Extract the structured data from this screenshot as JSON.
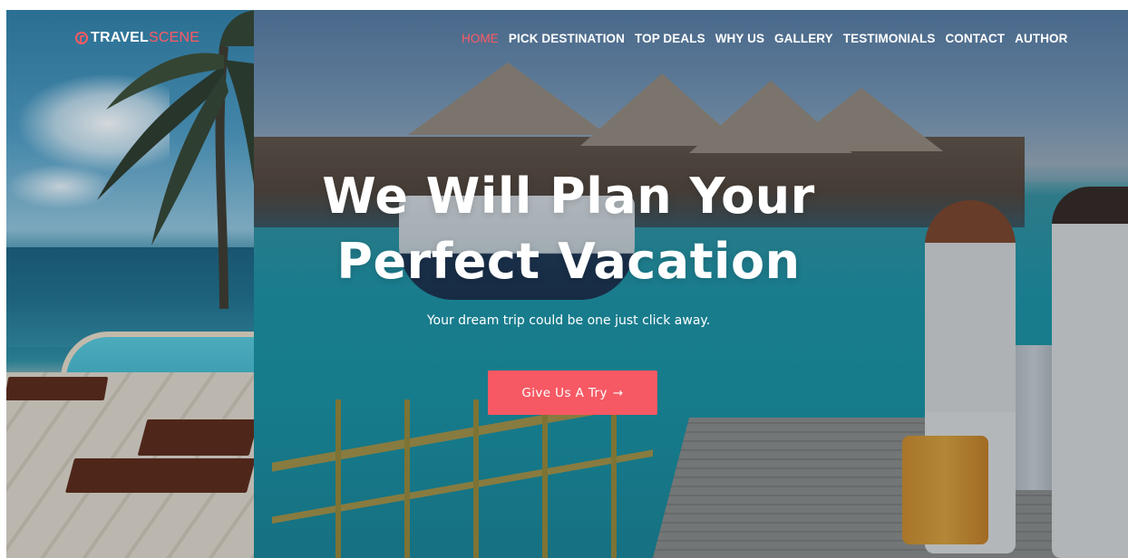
{
  "brand": {
    "logo_main": "TRAVEL",
    "logo_accent": "SCENE",
    "accent_color": "#ff5a63"
  },
  "nav": {
    "items": [
      {
        "label": "HOME",
        "active": true
      },
      {
        "label": "PICK DESTINATION",
        "active": false
      },
      {
        "label": "TOP DEALS",
        "active": false
      },
      {
        "label": "WHY US",
        "active": false
      },
      {
        "label": "GALLERY",
        "active": false
      },
      {
        "label": "TESTIMONIALS",
        "active": false
      },
      {
        "label": "CONTACT",
        "active": false
      },
      {
        "label": "AUTHOR",
        "active": false
      }
    ]
  },
  "hero": {
    "headline_line1": "We Will Plan Your",
    "headline_line2": "Perfect Vacation",
    "subheadline": "Your dream trip could be one just click away.",
    "cta_label": "Give Us A Try",
    "cta_arrow": "→",
    "cta_color": "#f65963"
  },
  "icons": {
    "logo": "compass-icon",
    "cta": "arrow-right-icon"
  }
}
